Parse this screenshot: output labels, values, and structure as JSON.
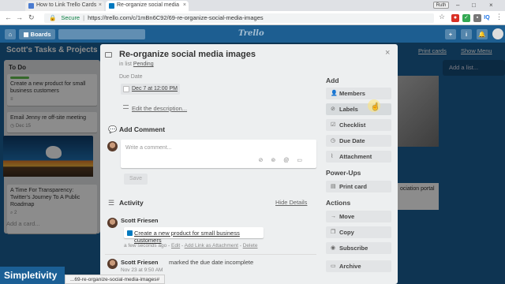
{
  "browser": {
    "tabs": [
      {
        "label": "How to Link Trello Cards",
        "favicon_color": "#4a7bd0"
      },
      {
        "label": "Re-organize social media",
        "favicon_color": "#0079bf"
      }
    ],
    "user_chip": "Ruth",
    "url_secure_label": "Secure",
    "url": "https://trello.com/c/1mBn6C92/69-re-organize-social-media-images",
    "extensions": [
      "ABP",
      "IQ"
    ],
    "status_url": "...69-re-organize-social-media-images#"
  },
  "header": {
    "boards_label": "Boards",
    "logo_text": "Trello",
    "actions": [
      "+",
      "i",
      "🔔"
    ]
  },
  "board": {
    "title": "Scott's Tasks & Projects",
    "print_cards": "Print cards",
    "show_menu": "Show Menu",
    "add_list": "Add a list...",
    "peek_card_text": "ociation portal",
    "list": {
      "title": "To Do",
      "cards": [
        {
          "text": "Create a new product for small business customers",
          "label_color": "#61bd4f"
        },
        {
          "text": "Email Jenny re off-site meeting",
          "badge": "Dec 15"
        },
        {
          "text": "A Time For Transparency: Twitter's Journey To A Public Roadmap",
          "badge": "2"
        }
      ],
      "add_card": "Add a card..."
    }
  },
  "card": {
    "title": "Re-organize social media images",
    "in_list_prefix": "in list",
    "list_name": "Pending",
    "due_label": "Due Date",
    "due_value": "Dec 7 at 12:00 PM",
    "edit_description": "Edit the description...",
    "add_comment_title": "Add Comment",
    "comment_placeholder": "Write a comment...",
    "save_label": "Save",
    "activity_title": "Activity",
    "hide_details": "Hide Details",
    "activity": [
      {
        "author": "Scott Friesen",
        "attachment": "Create a new product for small business customers",
        "meta_time": "a few seconds ago",
        "meta_edit": "Edit",
        "meta_add_link": "Add Link as Attachment",
        "meta_delete": "Delete"
      },
      {
        "author": "Scott Friesen",
        "text": "marked the due date incomplete",
        "date": "Nov 23 at 9:50 AM"
      }
    ]
  },
  "sidebar": {
    "add_heading": "Add",
    "add_buttons": [
      {
        "label": "Members",
        "icon": "user-icon"
      },
      {
        "label": "Labels",
        "icon": "tag-icon"
      },
      {
        "label": "Checklist",
        "icon": "checklist-icon"
      },
      {
        "label": "Due Date",
        "icon": "clock-icon"
      },
      {
        "label": "Attachment",
        "icon": "paperclip-icon"
      }
    ],
    "powerups_heading": "Power-Ups",
    "powerups_buttons": [
      {
        "label": "Print card",
        "icon": "printer-icon"
      }
    ],
    "actions_heading": "Actions",
    "actions_buttons": [
      {
        "label": "Move",
        "icon": "arrow-right-icon"
      },
      {
        "label": "Copy",
        "icon": "copy-icon"
      },
      {
        "label": "Subscribe",
        "icon": "eye-icon"
      },
      {
        "label": "Archive",
        "icon": "archive-icon"
      }
    ]
  },
  "brand_watermark": "Simpletivity",
  "colors": {
    "trello_blue": "#1d5e91",
    "label_green": "#61bd4f",
    "modal_bg": "#edeff0"
  }
}
